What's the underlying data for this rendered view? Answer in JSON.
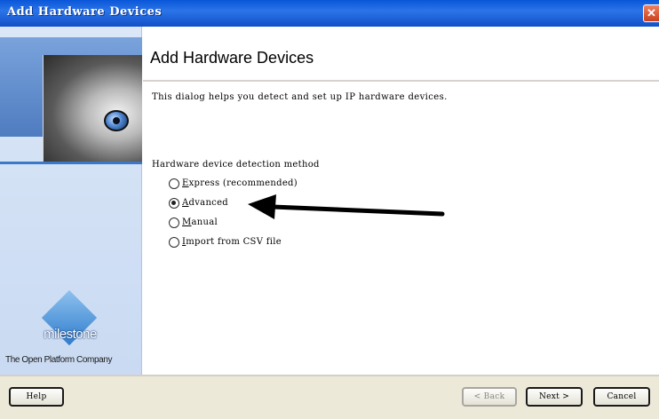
{
  "window": {
    "title": "Add Hardware Devices",
    "close_glyph": "✕"
  },
  "sidebar": {
    "logo_name": "milestone",
    "tagline": "The Open Platform Company"
  },
  "content": {
    "heading": "Add Hardware Devices",
    "description": "This dialog helps you detect and set up IP hardware devices.",
    "group_label": "Hardware device detection method",
    "options": [
      {
        "label": "Express (recommended)",
        "checked": false
      },
      {
        "label": "Advanced",
        "checked": true
      },
      {
        "label": "Manual",
        "checked": false
      },
      {
        "label": "Import from CSV file",
        "checked": false
      }
    ]
  },
  "buttons": {
    "help": "Help",
    "back": "< Back",
    "next": "Next >",
    "cancel": "Cancel"
  },
  "colors": {
    "titlebar": "#0a56d8",
    "sidebar": "#dbe7f7",
    "footer": "#ece9d8",
    "accent": "#3c78c8"
  }
}
